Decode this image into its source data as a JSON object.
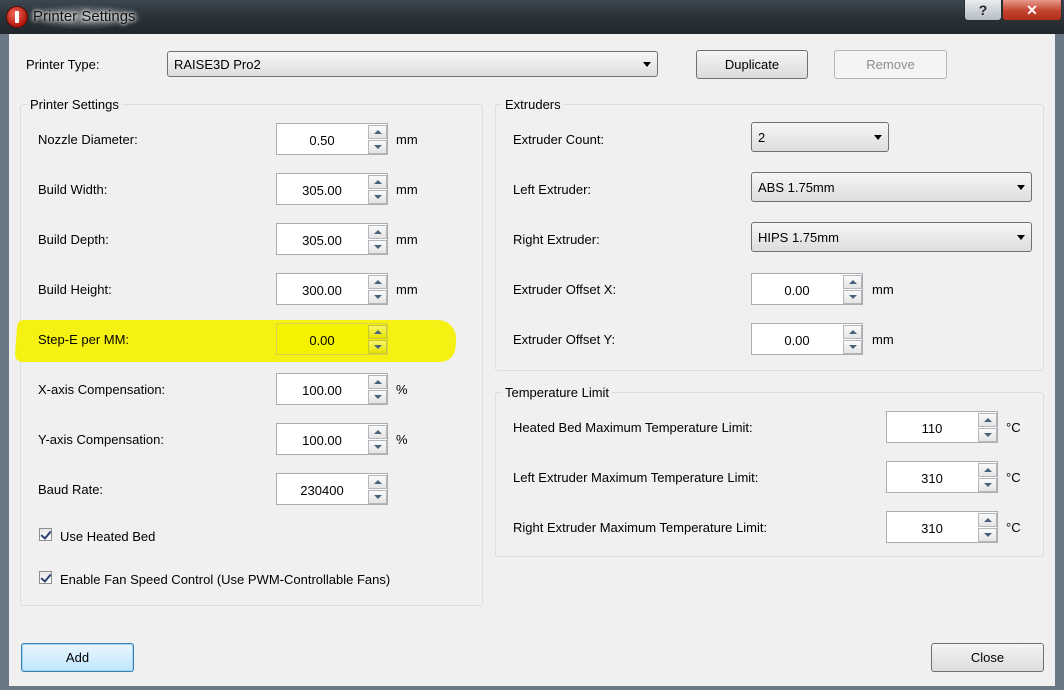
{
  "window": {
    "title": "Printer Settings",
    "help_label": "?",
    "close_label": "✕"
  },
  "printer_type": {
    "label": "Printer Type:",
    "value": "RAISE3D Pro2"
  },
  "buttons": {
    "duplicate": "Duplicate",
    "remove": "Remove",
    "add": "Add",
    "close": "Close"
  },
  "printer_settings": {
    "title": "Printer Settings",
    "fields": [
      {
        "label": "Nozzle Diameter:",
        "value": "0.50",
        "unit": "mm"
      },
      {
        "label": "Build Width:",
        "value": "305.00",
        "unit": "mm"
      },
      {
        "label": "Build Depth:",
        "value": "305.00",
        "unit": "mm"
      },
      {
        "label": "Build Height:",
        "value": "300.00",
        "unit": "mm"
      },
      {
        "label": "Step-E per MM:",
        "value": "0.00",
        "unit": ""
      },
      {
        "label": "X-axis Compensation:",
        "value": "100.00",
        "unit": "%"
      },
      {
        "label": "Y-axis Compensation:",
        "value": "100.00",
        "unit": "%"
      },
      {
        "label": "Baud Rate:",
        "value": "230400",
        "unit": ""
      }
    ],
    "checkboxes": [
      {
        "label": "Use Heated Bed",
        "checked": true
      },
      {
        "label": "Enable Fan Speed Control (Use PWM-Controllable Fans)",
        "checked": true
      }
    ]
  },
  "extruders": {
    "title": "Extruders",
    "count_label": "Extruder Count:",
    "count_value": "2",
    "left_label": "Left Extruder:",
    "left_value": "ABS 1.75mm",
    "right_label": "Right Extruder:",
    "right_value": "HIPS 1.75mm",
    "offset_x_label": "Extruder Offset X:",
    "offset_x_value": "0.00",
    "offset_x_unit": "mm",
    "offset_y_label": "Extruder Offset Y:",
    "offset_y_value": "0.00",
    "offset_y_unit": "mm"
  },
  "temperature_limit": {
    "title": "Temperature Limit",
    "fields": [
      {
        "label": "Heated Bed Maximum Temperature Limit:",
        "value": "110",
        "unit": "°C"
      },
      {
        "label": "Left Extruder Maximum Temperature Limit:",
        "value": "310",
        "unit": "°C"
      },
      {
        "label": "Right Extruder Maximum Temperature Limit:",
        "value": "310",
        "unit": "°C"
      }
    ]
  },
  "colors": {
    "highlight": "#f5f200",
    "close_button": "#c2422e"
  }
}
